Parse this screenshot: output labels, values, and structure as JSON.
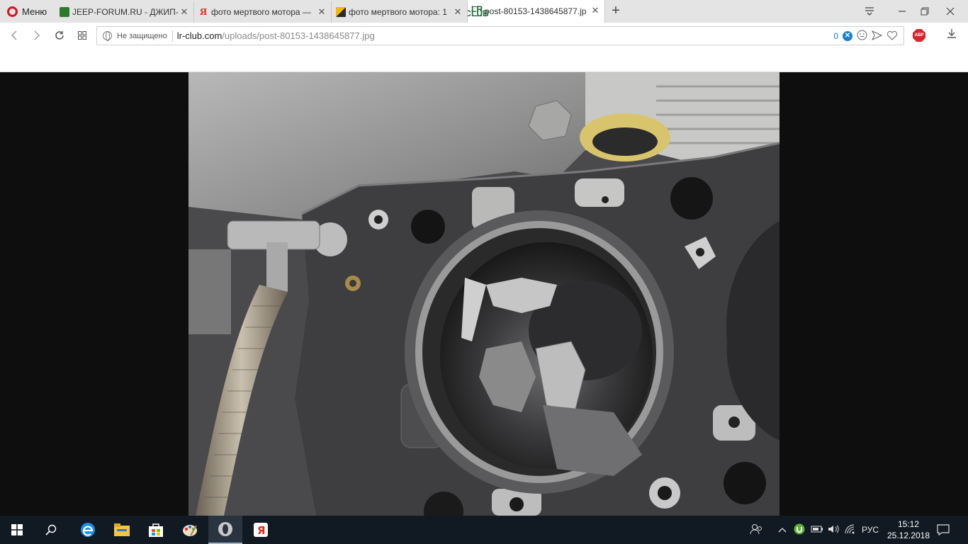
{
  "browser": {
    "menu_label": "Меню",
    "tabs": [
      {
        "title": "JEEP-FORUM.RU - ДЖИП-",
        "favicon": "jeep-forum-icon",
        "active": false
      },
      {
        "title": "фото мертвого мотора —",
        "favicon": "yandex-icon",
        "active": false
      },
      {
        "title": "фото мертвого мотора: 1",
        "favicon": "image-icon",
        "active": false
      },
      {
        "title": "post-80153-1438645877.jp",
        "favicon": "lr-club-icon",
        "active": true
      }
    ],
    "new_tab": "+",
    "address": {
      "security_label": "Не защищено",
      "domain": "lr-club.com",
      "path": "/uploads/post-80153-1438645877.jpg",
      "blocked_count": "0"
    },
    "abp_label": "ABP"
  },
  "image": {
    "description_icon": "engine-photo"
  },
  "taskbar": {
    "language": "РУС",
    "time": "15:12",
    "date": "25.12.2018",
    "pinned": [
      "start-icon",
      "search-icon",
      "edge-icon",
      "file-explorer-icon",
      "store-icon",
      "paint-icon",
      "opera-icon",
      "yandex-browser-icon"
    ]
  },
  "colors": {
    "opera_red": "#d9121f",
    "accent_blue": "#1a7fd0",
    "taskbar_bg": "#111a23"
  }
}
